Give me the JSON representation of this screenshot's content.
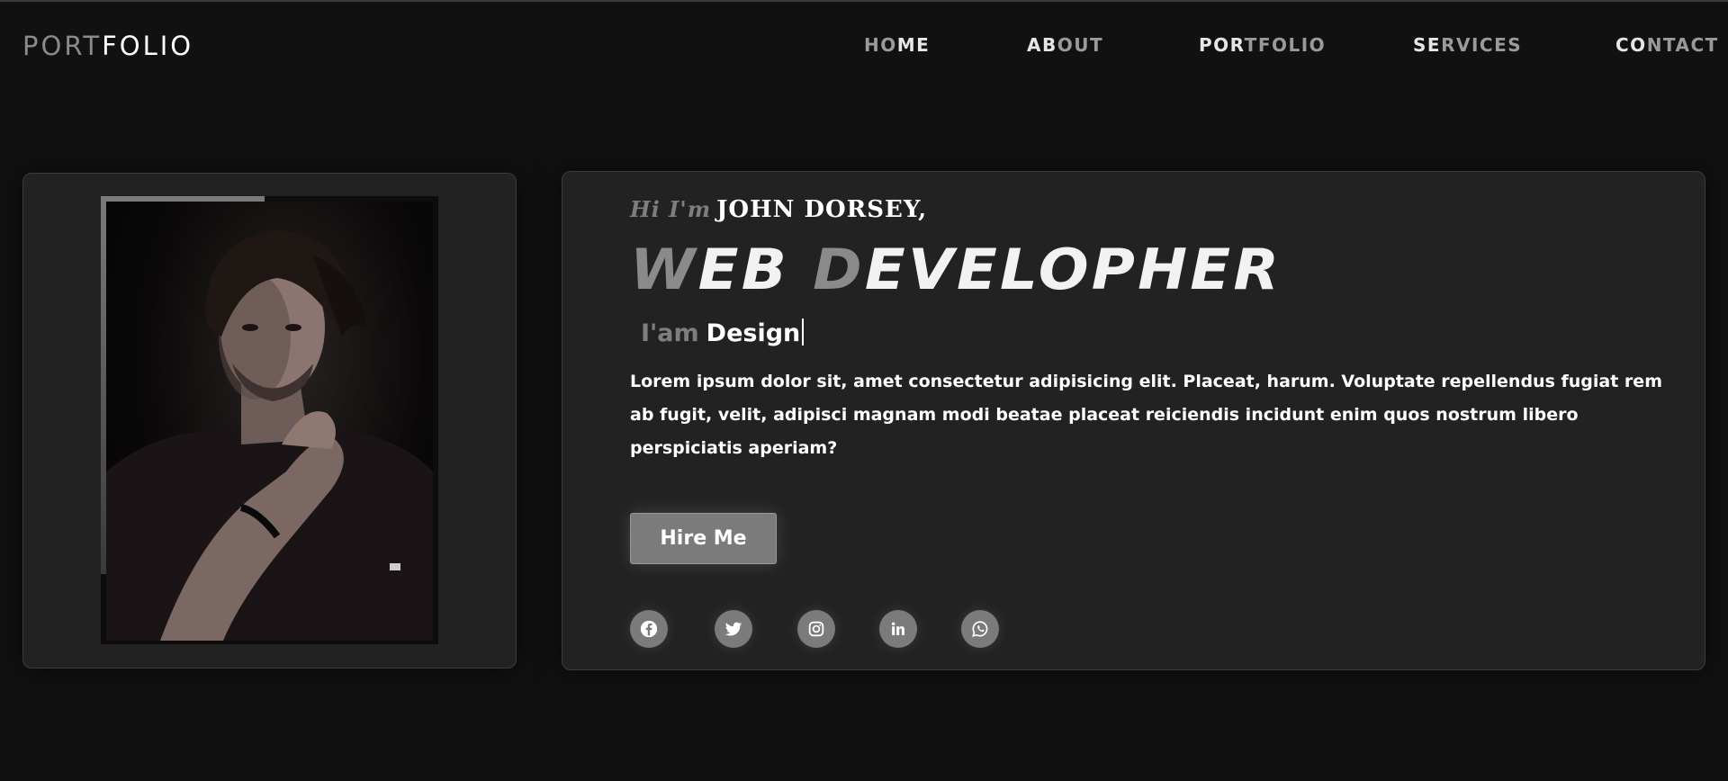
{
  "logo": {
    "part1": "PORT",
    "part2": "F",
    "part3": "OLIO"
  },
  "nav": {
    "items": [
      {
        "hl": "HO",
        "rest": "ME"
      },
      {
        "hl": "AB",
        "rest": "OUT"
      },
      {
        "hl": "POR",
        "rest": "TFOLIO"
      },
      {
        "hl": "SE",
        "rest": "RVICES"
      },
      {
        "hl": "CO",
        "rest": "NTACT"
      }
    ]
  },
  "hero": {
    "greeting_prefix": "Hi I'm",
    "name": "JOHN DORSEY,",
    "title_hl1": "W",
    "title_part1": "EB ",
    "title_hl2": "D",
    "title_part2": "EVELOPHER",
    "role_prefix": "I'am",
    "role_value": "Design",
    "description": "Lorem ipsum dolor sit, amet consectetur adipisicing elit. Placeat, harum. Voluptate repellendus fugiat rem ab fugit, velit, adipisci magnam modi beatae placeat reiciendis incidunt enim quos nostrum libero perspiciatis aperiam?",
    "cta_label": "Hire Me"
  },
  "social": [
    "facebook-icon",
    "twitter-icon",
    "instagram-icon",
    "linkedin-icon",
    "whatsapp-icon"
  ],
  "colors": {
    "background": "#111111",
    "card": "#222222",
    "accent": "#7b7b7b",
    "text": "#ffffff"
  }
}
